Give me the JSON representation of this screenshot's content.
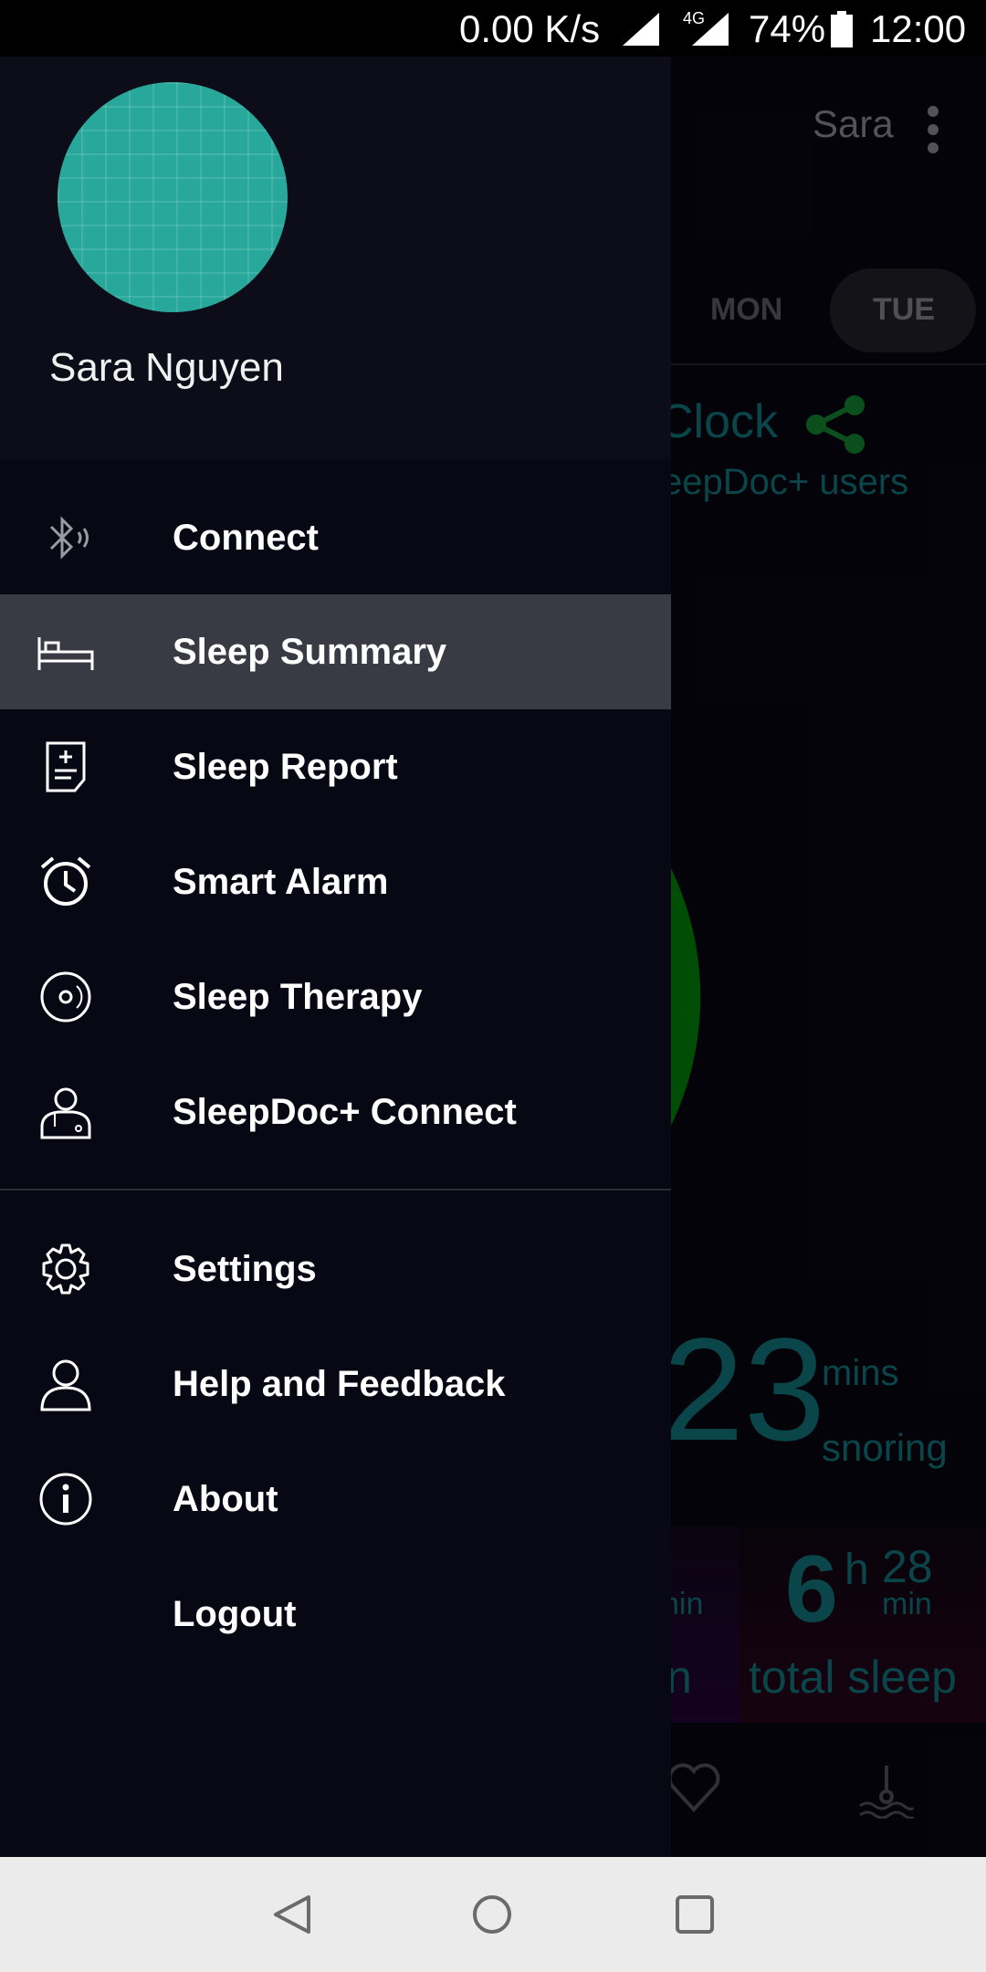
{
  "status_bar": {
    "speed": "0.00 K/s",
    "network": "4G",
    "battery": "74%",
    "time": "12:00"
  },
  "background_app": {
    "user": "Sara",
    "days": [
      "MON",
      "TUE"
    ],
    "clock_text": "Clock",
    "users_text": "eepDoc+ users",
    "snoring_value": "23",
    "snoring_unit": "mins",
    "snoring_label": "snoring",
    "left_unit": "nin",
    "left_label": "n",
    "sleep_hours": "6",
    "sleep_h_unit": "h",
    "sleep_minutes": "28",
    "sleep_min_unit": "min",
    "sleep_label": "total sleep",
    "colors": {
      "ring": "#00790a",
      "teal": "#0f6a70",
      "share": "#127a2c"
    }
  },
  "drawer": {
    "user_name": "Sara Nguyen",
    "menu": [
      {
        "label": "Connect",
        "icon": "bluetooth-icon"
      },
      {
        "label": "Sleep Summary",
        "icon": "bed-icon",
        "active": true
      },
      {
        "label": "Sleep Report",
        "icon": "report-icon"
      },
      {
        "label": "Smart Alarm",
        "icon": "alarm-clock-icon"
      },
      {
        "label": "Sleep Therapy",
        "icon": "disc-icon"
      },
      {
        "label": "SleepDoc+ Connect",
        "icon": "doctor-icon"
      }
    ],
    "secondary_menu": [
      {
        "label": "Settings",
        "icon": "gear-icon"
      },
      {
        "label": "Help and Feedback",
        "icon": "user-icon"
      },
      {
        "label": "About",
        "icon": "info-icon"
      },
      {
        "label": "Logout",
        "icon": ""
      }
    ]
  }
}
